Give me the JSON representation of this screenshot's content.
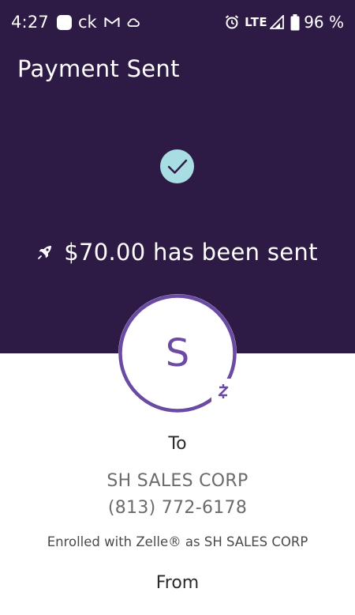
{
  "status_bar": {
    "time": "4:27",
    "app_text": "ck",
    "network": "LTE",
    "battery_percent": "96 %"
  },
  "header": {
    "title": "Payment Sent"
  },
  "confirmation": {
    "icon": "checkmark-icon",
    "message": "$70.00 has been sent",
    "message_icon": "rocket-icon"
  },
  "recipient": {
    "initial": "S",
    "badge_icon": "zelle-icon",
    "to_label": "To",
    "name": "SH SALES CORP",
    "phone": "(813) 772-6178",
    "enrolled_note": "Enrolled with Zelle® as SH SALES CORP"
  },
  "sender": {
    "from_label": "From"
  },
  "colors": {
    "header_bg": "#2d1b45",
    "accent_purple": "#6b4aa3",
    "check_bg": "#a8dde3"
  }
}
